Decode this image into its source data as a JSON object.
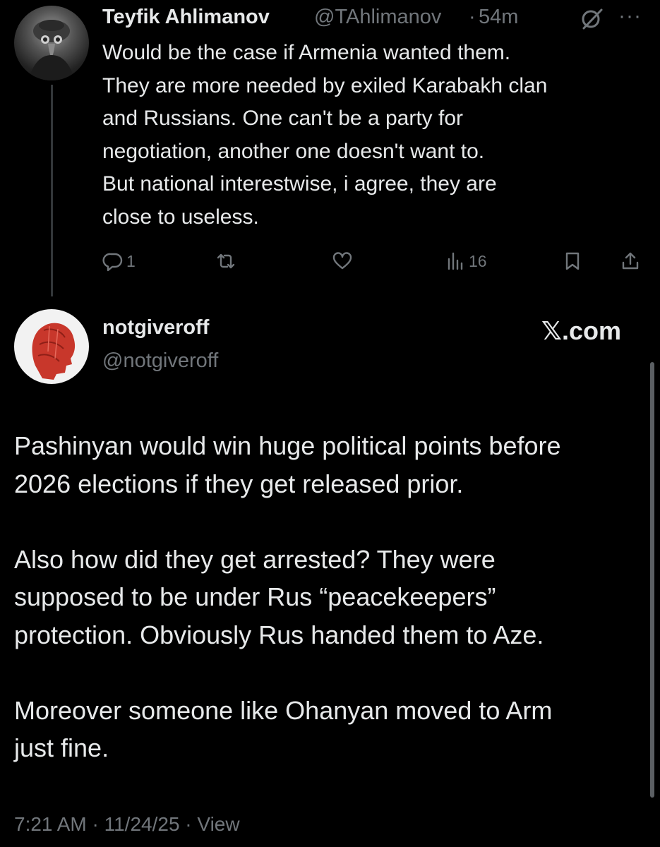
{
  "reply": {
    "author_name": "Teyfik Ahlimanov",
    "author_handle": "@TAhlimanov",
    "separator": "·",
    "time": "54m",
    "body_lines": [
      "Would be the case if Armenia wanted them.",
      "They are more needed by exiled Karabakh clan",
      "and Russians. One can't be a party for",
      "negotiation, another one doesn't want to.",
      "But national interestwise, i agree, they are",
      "close to useless."
    ],
    "actions": {
      "reply_count": "1",
      "repost_count": "",
      "like_count": "",
      "views_count": "16"
    }
  },
  "quoted": {
    "author_name": "notgiveroff",
    "author_handle": "@notgiveroff",
    "site_label": "𝕏.com",
    "paragraphs": [
      [
        "Pashinyan would win huge political points before",
        "2026 elections if they get released prior."
      ],
      [
        "Also how did they get arrested? They were",
        "supposed to be under Rus “peacekeepers”",
        "protection. Obviously Rus handed them to Aze."
      ],
      [
        "Moreover someone like Ohanyan moved to Arm",
        "just fine."
      ]
    ],
    "footer": "7:21 AM · 11/24/25 · View"
  },
  "icons": {
    "grok": "grok-icon",
    "more": "more-icon",
    "reply": "reply-icon",
    "repost": "repost-icon",
    "like": "heart-icon",
    "views": "views-icon",
    "bookmark": "bookmark-icon",
    "share": "share-icon"
  },
  "colors": {
    "background": "#000000",
    "text": "#e7e9ea",
    "muted": "#71767b",
    "thread_line": "#333639"
  }
}
